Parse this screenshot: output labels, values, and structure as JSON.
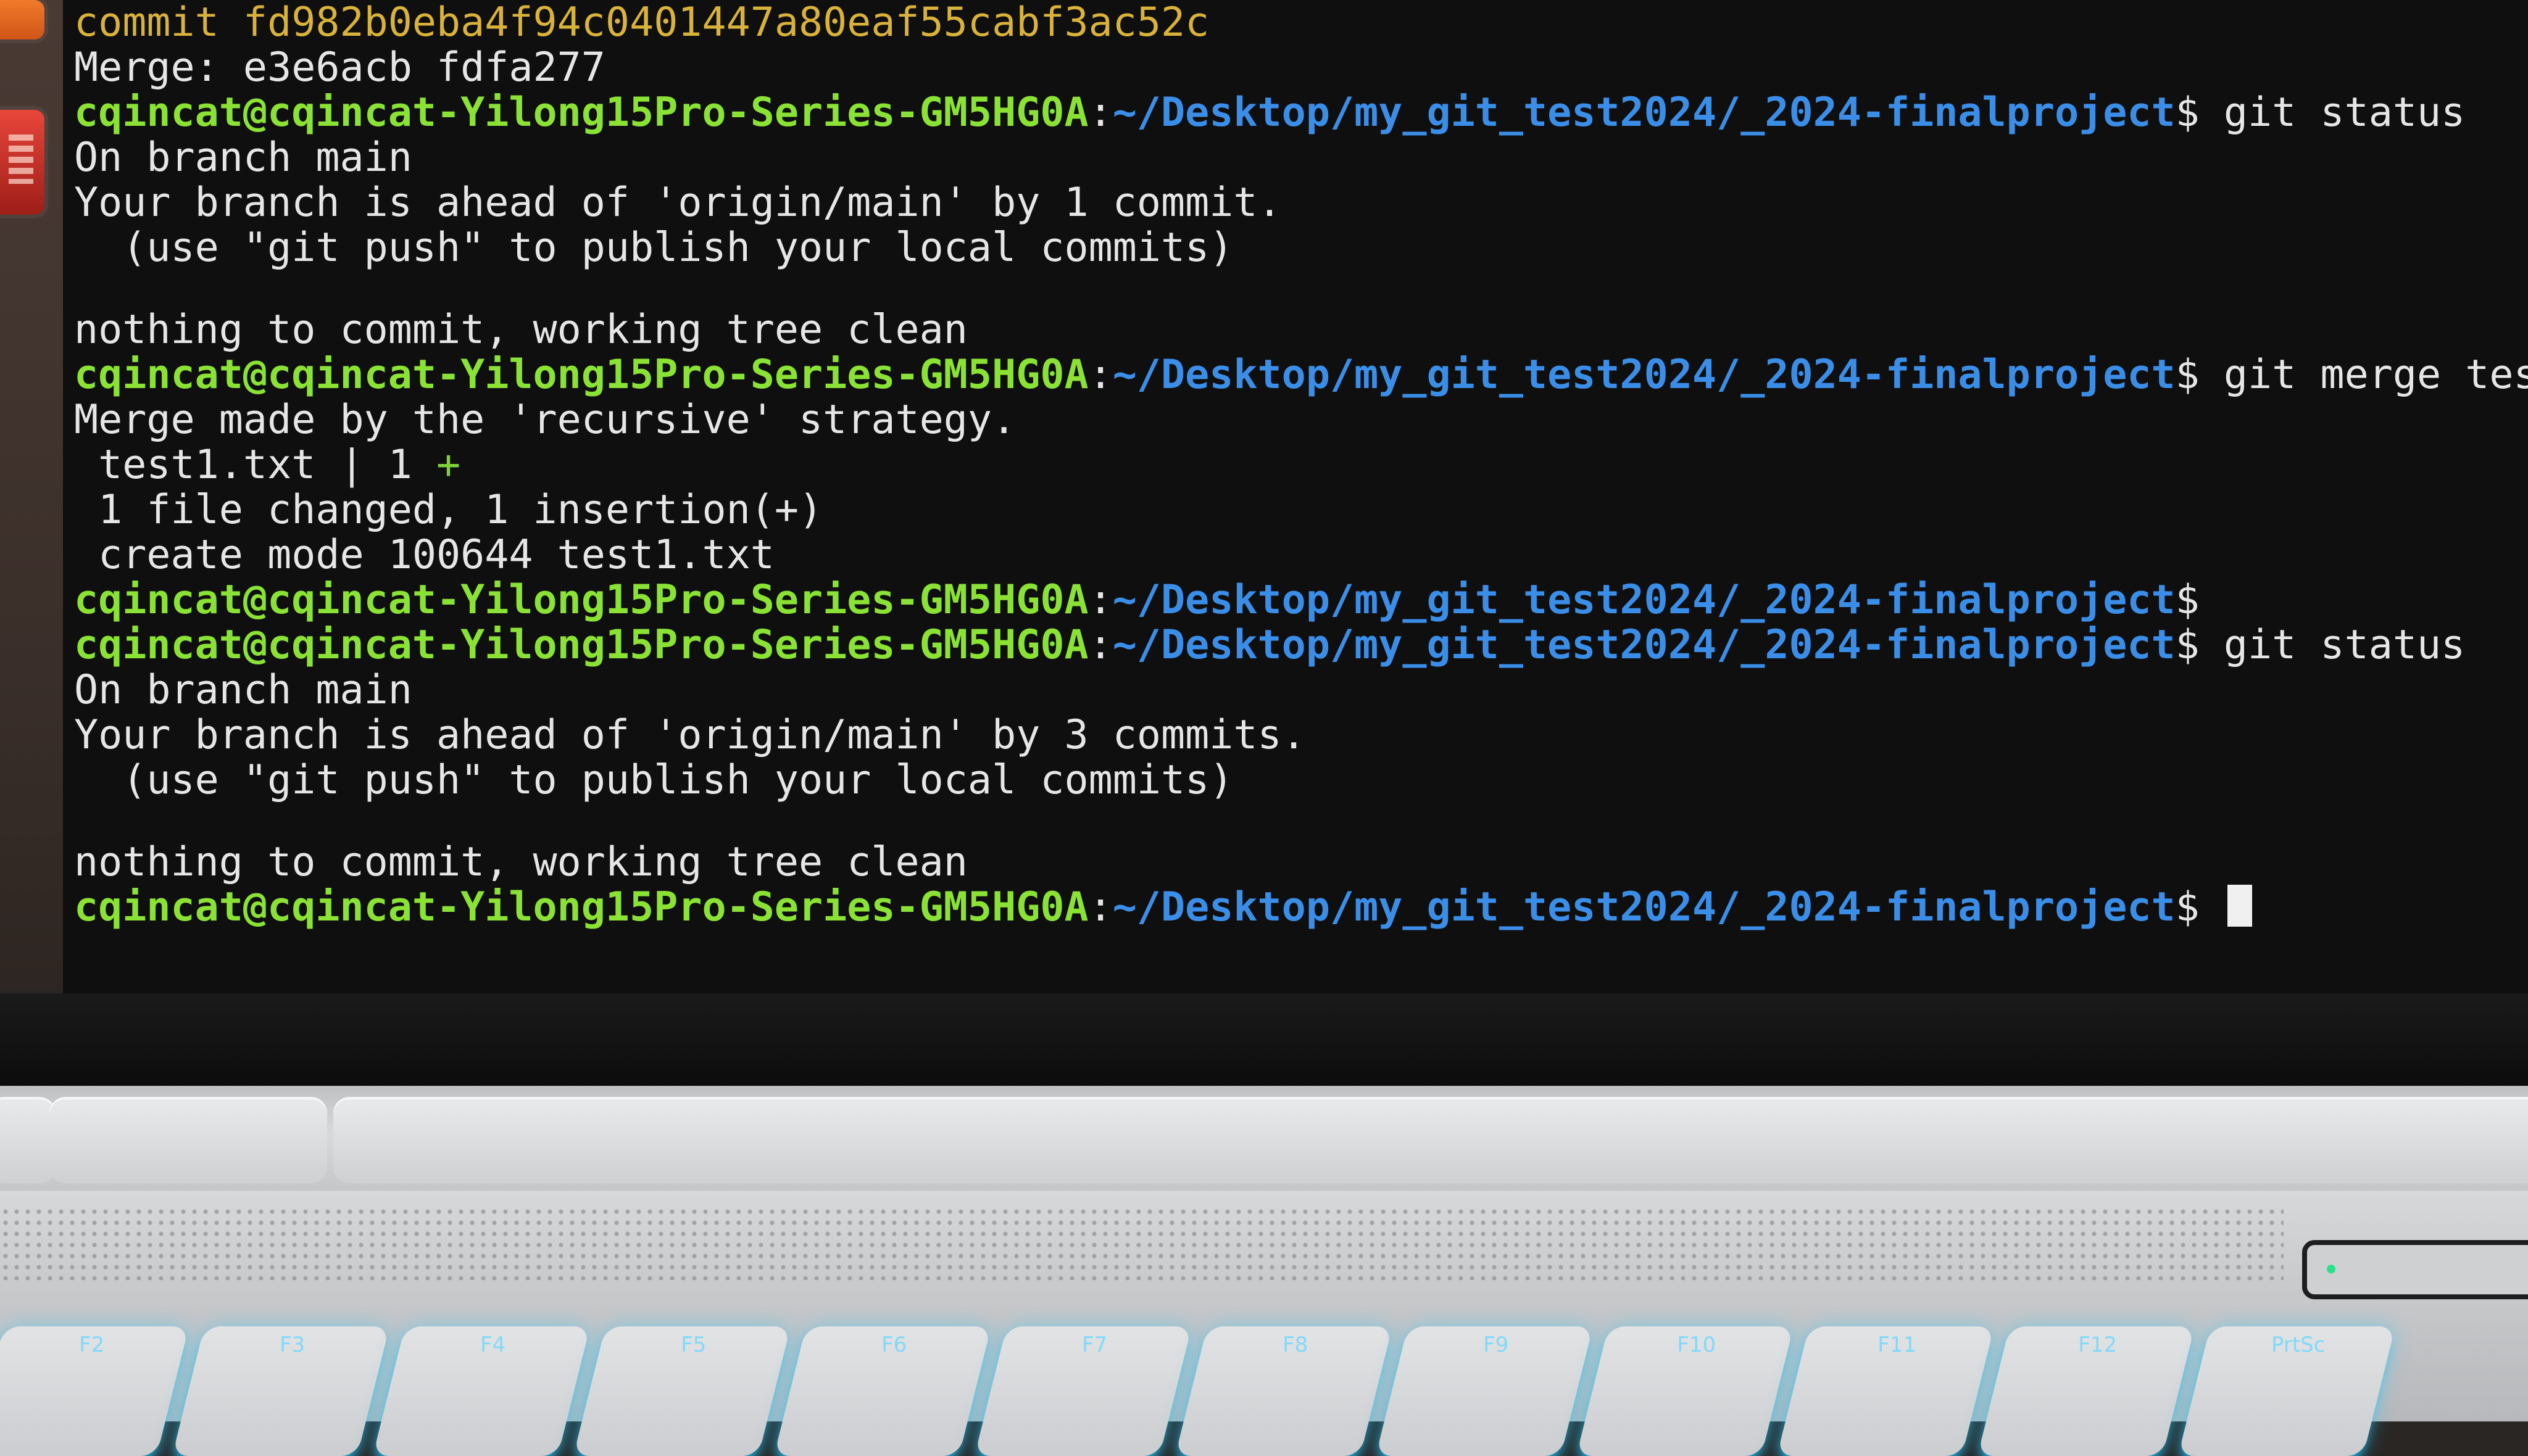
{
  "terminal": {
    "lines": [
      {
        "type": "text",
        "class": "yellow",
        "text": "commit fd982b0eba4f94c0401447a80eaf55cabf3ac52c"
      },
      {
        "type": "text",
        "text": "Merge: e3e6acb fdfa277"
      },
      {
        "type": "prompt",
        "command": " git status"
      },
      {
        "type": "text",
        "text": "On branch main"
      },
      {
        "type": "text",
        "text": "Your branch is ahead of 'origin/main' by 1 commit."
      },
      {
        "type": "text",
        "text": "  (use \"git push\" to publish your local commits)"
      },
      {
        "type": "blank"
      },
      {
        "type": "text",
        "text": "nothing to commit, working tree clean"
      },
      {
        "type": "prompt",
        "command": " git merge test"
      },
      {
        "type": "text",
        "text": "Merge made by the 'recursive' strategy."
      },
      {
        "type": "diffstat",
        "file": " test1.txt | 1 ",
        "plus": "+"
      },
      {
        "type": "text",
        "text": " 1 file changed, 1 insertion(+)"
      },
      {
        "type": "text",
        "text": " create mode 100644 test1.txt"
      },
      {
        "type": "prompt",
        "command": ""
      },
      {
        "type": "prompt",
        "command": " git status"
      },
      {
        "type": "text",
        "text": "On branch main"
      },
      {
        "type": "text",
        "text": "Your branch is ahead of 'origin/main' by 3 commits."
      },
      {
        "type": "text",
        "text": "  (use \"git push\" to publish your local commits)"
      },
      {
        "type": "blank"
      },
      {
        "type": "text",
        "text": "nothing to commit, working tree clean"
      },
      {
        "type": "prompt",
        "command": " ",
        "cursor": true
      }
    ],
    "prompt_user": "cqincat@cqincat-Yilong15Pro-Series-GM5HG0A",
    "prompt_sep": ":",
    "prompt_path": "~/Desktop/my_git_test2024/_2024-finalproject",
    "prompt_dollar": "$"
  },
  "colors": {
    "background": "#0f0f0f",
    "text": "#e6e6e6",
    "prompt_user": "#8ae234",
    "prompt_path": "#3b8ee8",
    "commit_hash": "#d9b23a",
    "diff_plus": "#7fd33a"
  },
  "keyboard": {
    "keys": [
      "F2",
      "F3",
      "F4",
      "F5",
      "F6",
      "F7",
      "F8",
      "F9",
      "F10",
      "F11",
      "F12",
      "PrtSc"
    ]
  }
}
